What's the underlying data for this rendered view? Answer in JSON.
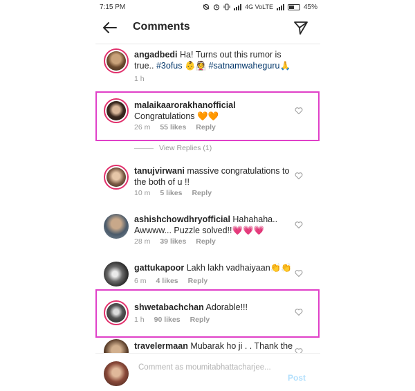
{
  "status_bar": {
    "time": "7:15 PM",
    "network": "4G VoLTE",
    "battery": "45%"
  },
  "header": {
    "title": "Comments"
  },
  "comments": [
    {
      "username": "angadbedi",
      "text": "Ha! Turns out this rumor is true.. ",
      "hashtag_1": "#3ofus",
      "emoji_1": "👶👰",
      "hashtag_2": "#satnamwaheguru",
      "emoji_2": "🙏",
      "time": "1 h"
    },
    {
      "username": "malaikaarorakhanofficial",
      "text": "Congratulations 🧡🧡",
      "time": "26 m",
      "likes": "55 likes",
      "reply": "Reply",
      "view_replies": "View Replies (1)"
    },
    {
      "username": "tanujvirwani",
      "text": "massive congratulations to the both of u !!",
      "time": "10 m",
      "likes": "5 likes",
      "reply": "Reply"
    },
    {
      "username": "ashishchowdhryofficial",
      "text": "Hahahaha.. Awwww... Puzzle solved!!💗💗💗",
      "time": "28 m",
      "likes": "39 likes",
      "reply": "Reply"
    },
    {
      "username": "gattukapoor",
      "text": "Lakh lakh vadhaiyaan👏👏",
      "time": "6 m",
      "likes": "4 likes",
      "reply": "Reply"
    },
    {
      "username": "shwetabachchan",
      "text": "Adorable!!!",
      "time": "1 h",
      "likes": "90 likes",
      "reply": "Reply"
    },
    {
      "username": "travelermaan",
      "text": "Mubarak ho ji . . Thank the"
    }
  ],
  "compose": {
    "placeholder": "Comment as moumitabhattacharjee...",
    "post": "Post"
  },
  "colors": {
    "highlight": "#e040c8",
    "story_ring": "#e1306c",
    "hashtag": "#003569",
    "post_disabled": "#b2dffc"
  }
}
